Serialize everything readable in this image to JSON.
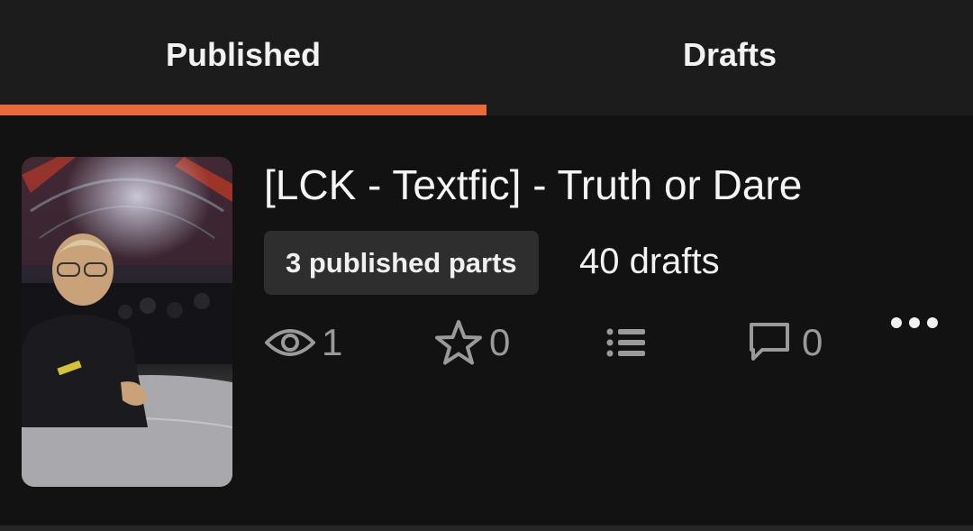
{
  "tabs": [
    {
      "label": "Published",
      "active": true
    },
    {
      "label": "Drafts",
      "active": false
    }
  ],
  "accent_color": "#e96a3b",
  "story": {
    "title": "[LCK - Textfic] - Truth or Dare",
    "published_badge": "3 published parts",
    "drafts": "40 drafts",
    "stats": {
      "views": "1",
      "votes": "0",
      "comments": "0"
    },
    "icons": [
      "eye-icon",
      "star-icon",
      "list-icon",
      "comment-icon",
      "more-icon"
    ]
  }
}
